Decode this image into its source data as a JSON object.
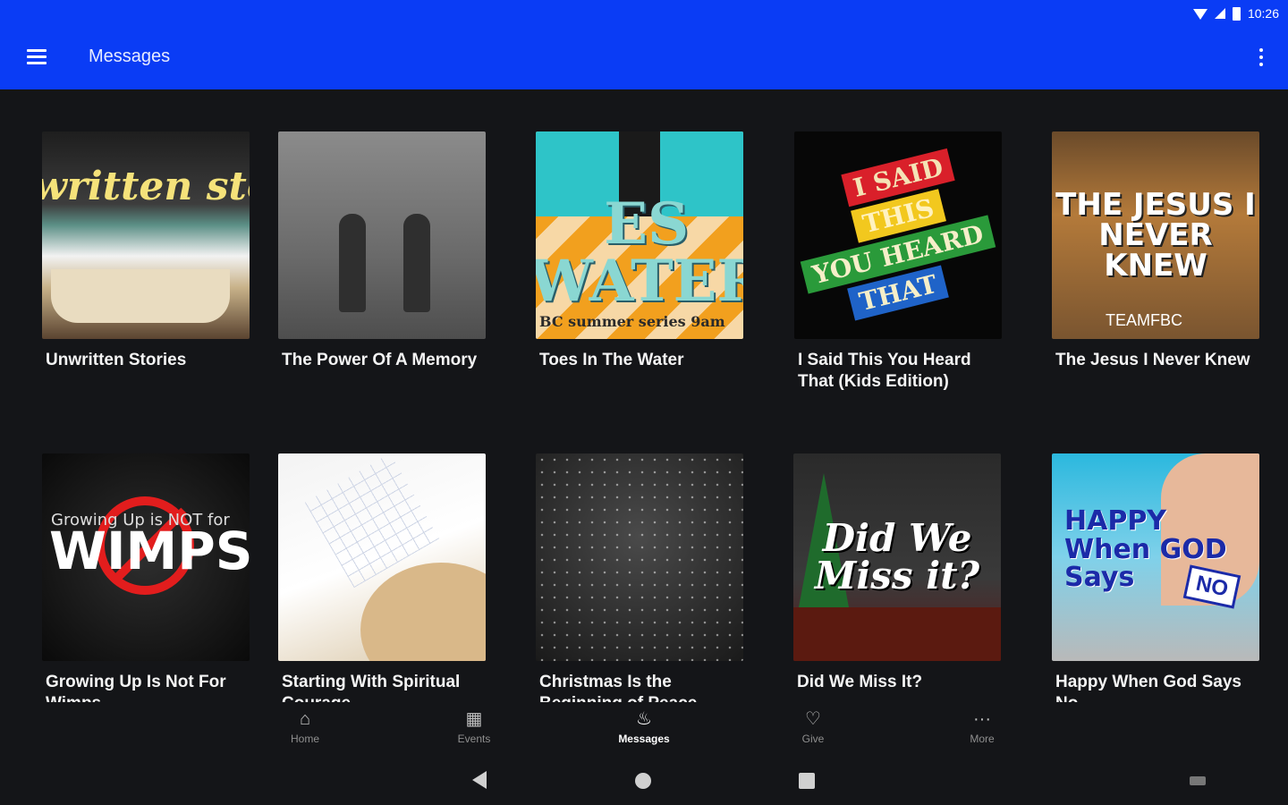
{
  "status_bar": {
    "time": "10:26"
  },
  "app_bar": {
    "title": "Messages"
  },
  "messages": [
    {
      "title": "Unwritten Stories",
      "art_text": "written sto"
    },
    {
      "title": "The Power Of A Memory"
    },
    {
      "title": "Toes In The Water",
      "art_text": "ES\nWATER",
      "art_sub": "BC summer series  9am"
    },
    {
      "title": "I Said This You Heard That (Kids Edition)",
      "art_lines": [
        "I SAID",
        "THIS",
        "YOU HEARD",
        "THAT"
      ]
    },
    {
      "title": "The Jesus I Never Knew",
      "art_text": "THE JESUS I NEVER KNEW",
      "art_sub": "TEAMFBC"
    },
    {
      "title": "Growing Up Is Not For Wimps",
      "art_top": "Growing Up is NOT for",
      "art_text": "WIMPS"
    },
    {
      "title": "Starting With Spiritual Courage"
    },
    {
      "title": "Christmas Is the Beginning of Peace"
    },
    {
      "title": "Did We Miss It?",
      "art_text": "Did We Miss it?"
    },
    {
      "title": "Happy When God Says No",
      "art_text": "HAPPY When GOD Says",
      "art_no": "NO"
    }
  ],
  "bottom_nav": [
    {
      "label": "Home",
      "icon": "home-icon"
    },
    {
      "label": "Events",
      "icon": "calendar-icon"
    },
    {
      "label": "Messages",
      "icon": "flame-icon",
      "active": true
    },
    {
      "label": "Give",
      "icon": "heart-icon"
    },
    {
      "label": "More",
      "icon": "more-horizontal-icon"
    }
  ],
  "colors": {
    "app_bar": "#0a3cf5",
    "background": "#141518"
  }
}
